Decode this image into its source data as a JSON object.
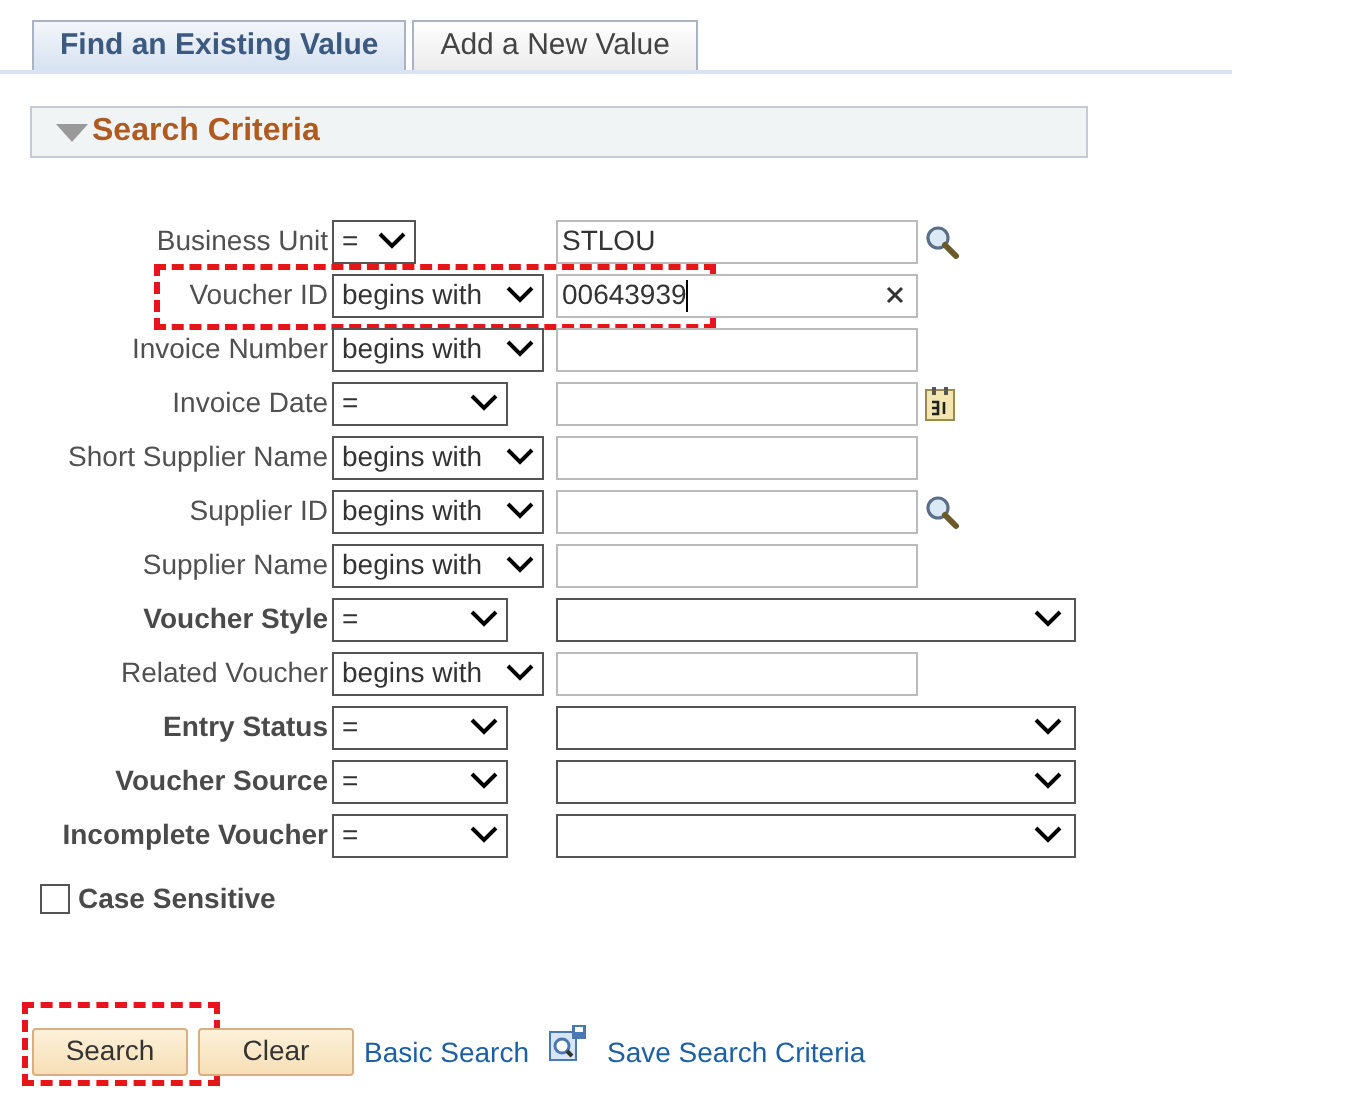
{
  "tabs": [
    {
      "label": "Find an Existing Value",
      "selected": true
    },
    {
      "label": "Add a New Value",
      "selected": false
    }
  ],
  "section": {
    "title": "Search Criteria",
    "expanded": true
  },
  "fields": [
    {
      "label": "Business Unit",
      "bold": false,
      "operator": "=",
      "kind": "text",
      "value": "STLOU",
      "highlighted": false
    },
    {
      "label": "Voucher ID",
      "bold": false,
      "operator": "begins with",
      "kind": "text",
      "value": "00643939",
      "highlighted": true
    },
    {
      "label": "Invoice Number",
      "bold": false,
      "operator": "begins with",
      "kind": "text",
      "highlighted": false
    },
    {
      "label": "Invoice Date",
      "bold": false,
      "operator": "=",
      "kind": "text",
      "highlighted": false
    },
    {
      "label": "Short Supplier Name",
      "bold": false,
      "operator": "begins with",
      "kind": "text",
      "highlighted": false
    },
    {
      "label": "Supplier ID",
      "bold": false,
      "operator": "begins with",
      "kind": "text",
      "highlighted": false
    },
    {
      "label": "Supplier Name",
      "bold": false,
      "operator": "begins with",
      "kind": "text",
      "highlighted": false
    },
    {
      "label": "Voucher Style",
      "bold": true,
      "operator": "=",
      "kind": "dropdown",
      "highlighted": false
    },
    {
      "label": "Related Voucher",
      "bold": false,
      "operator": "begins with",
      "kind": "text",
      "highlighted": false
    },
    {
      "label": "Entry Status",
      "bold": true,
      "operator": "=",
      "kind": "dropdown",
      "highlighted": false
    },
    {
      "label": "Voucher Source",
      "bold": true,
      "operator": "=",
      "kind": "dropdown",
      "highlighted": false
    },
    {
      "label": "Incomplete Voucher",
      "bold": true,
      "operator": "=",
      "kind": "dropdown",
      "highlighted": false
    }
  ],
  "case_sensitive": {
    "label": "Case Sensitive",
    "checked": false
  },
  "actions": [
    {
      "kind": "button",
      "label": "Search",
      "highlighted": true
    },
    {
      "kind": "button",
      "label": "Clear",
      "highlighted": false
    },
    {
      "kind": "link",
      "label": "Basic Search"
    },
    {
      "kind": "save-link",
      "label": "Save Search Criteria"
    }
  ]
}
